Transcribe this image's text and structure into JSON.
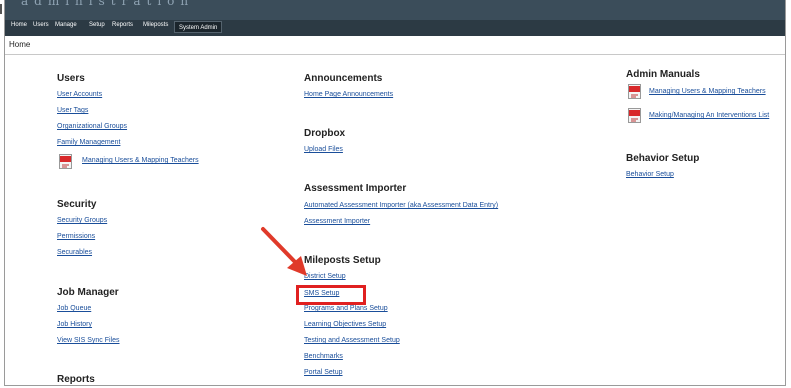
{
  "banner": {
    "title": "administration"
  },
  "nav": {
    "items": [
      "Home",
      "Users",
      "Manage",
      "Setup",
      "Reports",
      "Mileposts",
      "System Admin"
    ]
  },
  "breadcrumb": "Home",
  "users": {
    "heading": "Users",
    "links": [
      "User Accounts",
      "User Tags",
      "Organizational Groups",
      "Family Management"
    ],
    "pdf_link": "Managing Users & Mapping Teachers"
  },
  "security": {
    "heading": "Security",
    "links": [
      "Security Groups",
      "Permissions",
      "Securables"
    ]
  },
  "job_manager": {
    "heading": "Job Manager",
    "links": [
      "Job Queue",
      "Job History",
      "View SIS Sync Files"
    ]
  },
  "reports": {
    "heading": "Reports"
  },
  "announcements": {
    "heading": "Announcements",
    "links": [
      "Home Page Announcements"
    ]
  },
  "dropbox": {
    "heading": "Dropbox",
    "links": [
      "Upload Files"
    ]
  },
  "assessment_importer": {
    "heading": "Assessment Importer",
    "links": [
      "Automated Assessment Importer (aka Assessment Data Entry)",
      "Assessment Importer"
    ]
  },
  "mileposts_setup": {
    "heading": "Mileposts Setup",
    "links": [
      "District Setup",
      "SMS Setup",
      "Programs and Plans Setup",
      "Learning Objectives Setup",
      "Testing and Assessment Setup",
      "Benchmarks",
      "Portal Setup"
    ]
  },
  "admin_manuals": {
    "heading": "Admin Manuals",
    "links": [
      "Managing Users & Mapping Teachers",
      "Making/Managing An Interventions List"
    ]
  },
  "behavior_setup": {
    "heading": "Behavior Setup",
    "links": [
      "Behavior Setup"
    ]
  },
  "colors": {
    "banner": "#3b4d5a",
    "navbar": "#2c3a44",
    "link": "#1a4e9a",
    "highlight": "#e02020"
  }
}
